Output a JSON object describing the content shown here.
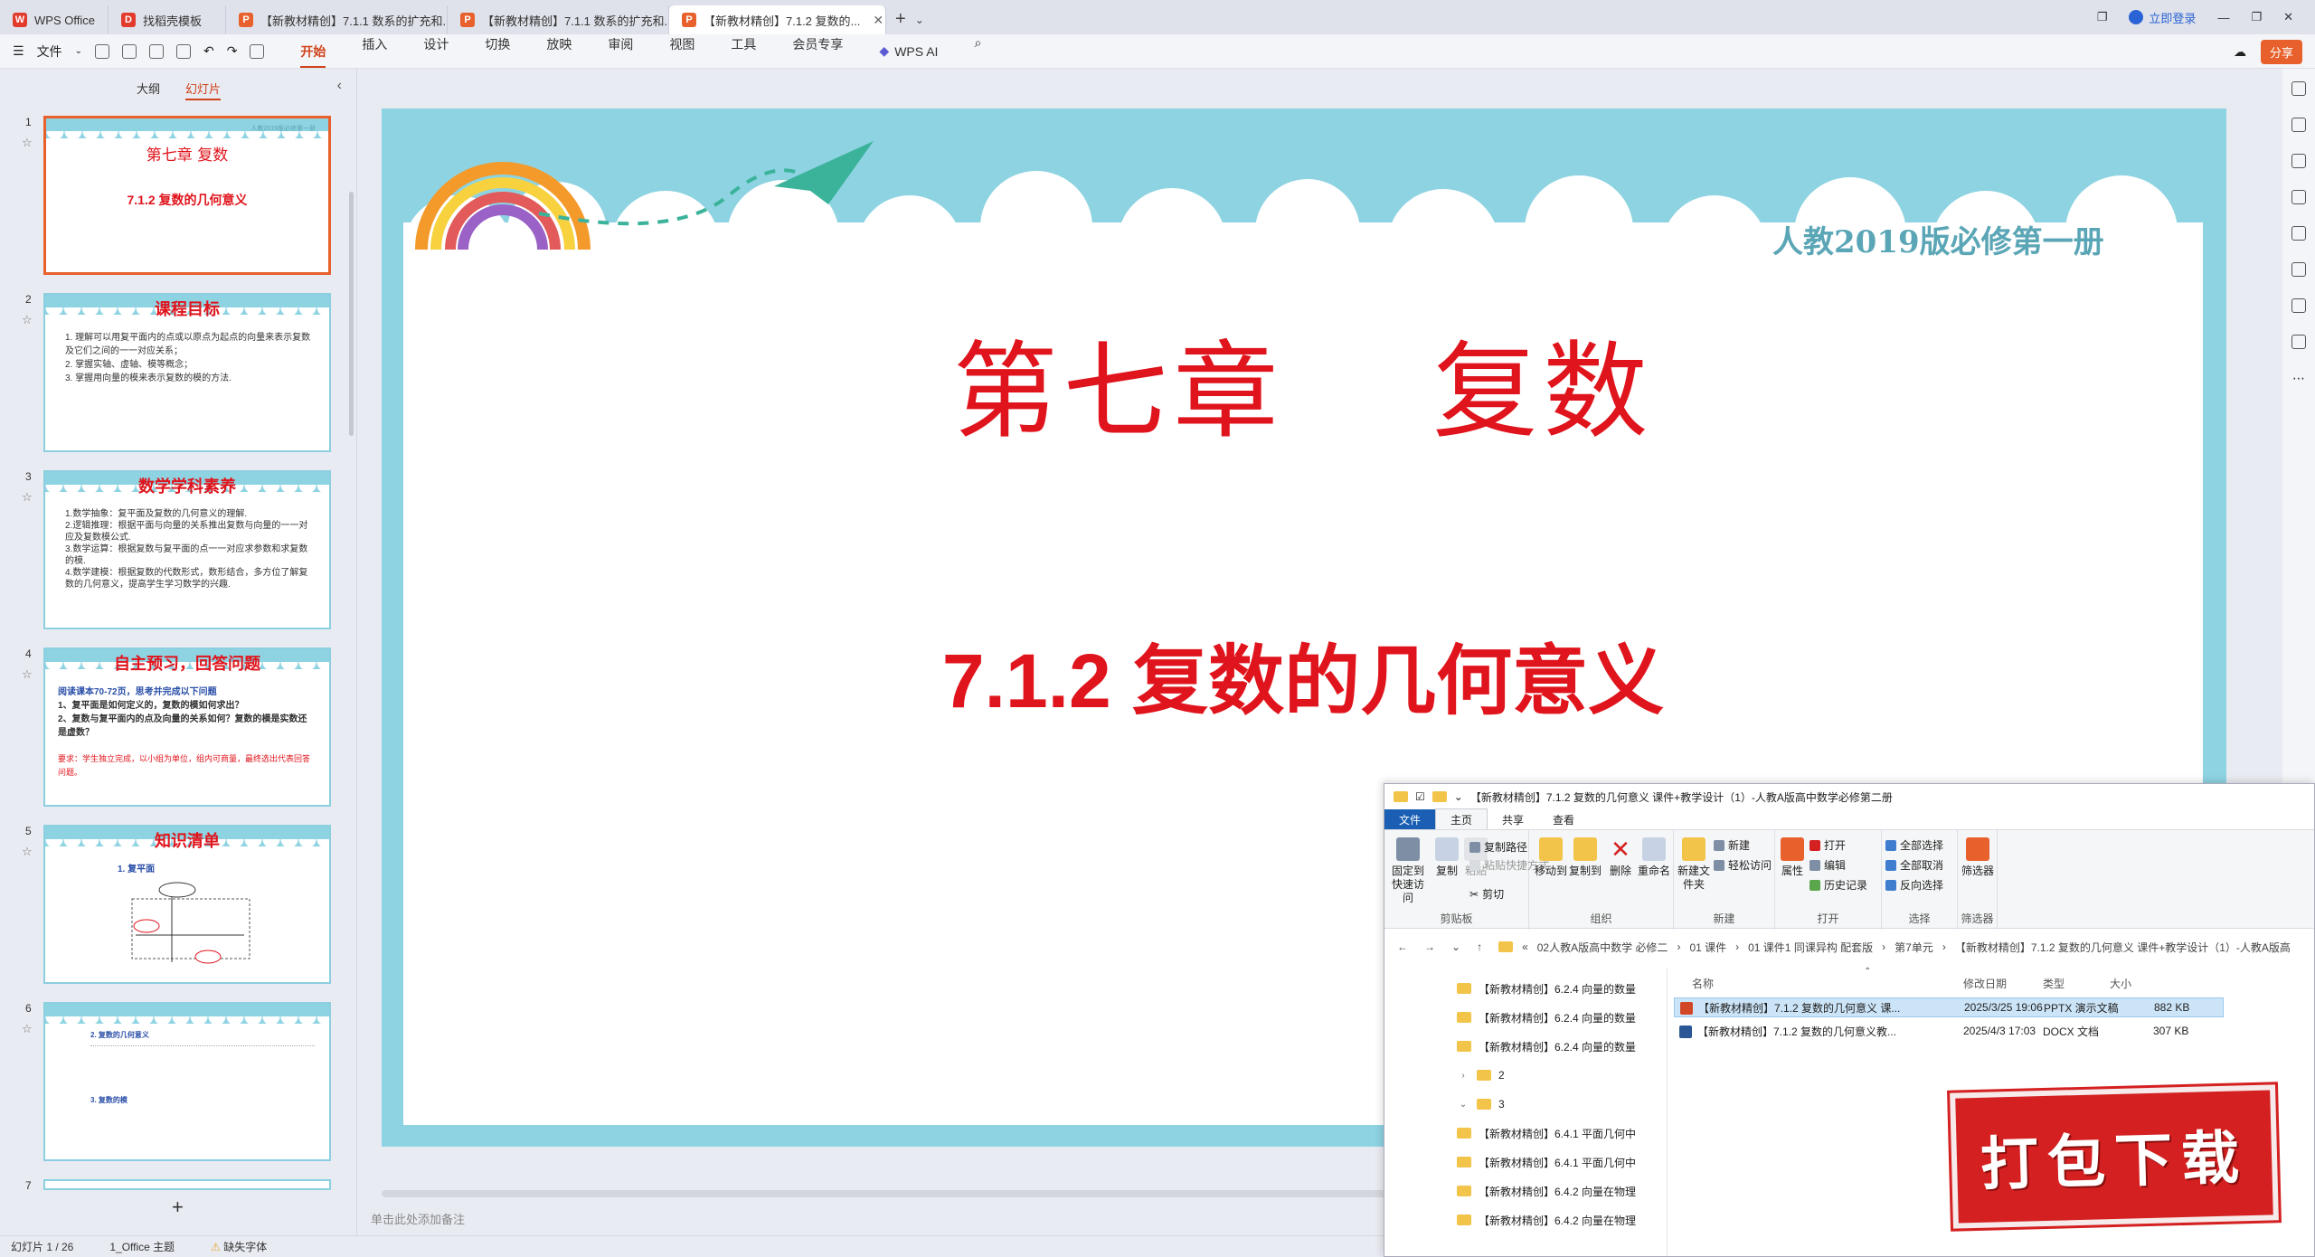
{
  "tabs": [
    {
      "label": "WPS Office",
      "color": "#e23b2e",
      "glyph": "W"
    },
    {
      "label": "找稻壳模板",
      "color": "#e23b2e",
      "glyph": "D"
    },
    {
      "label": "【新教材精创】7.1.1 数系的扩充和...",
      "color": "#e8612c",
      "glyph": "P"
    },
    {
      "label": "【新教材精创】7.1.1 数系的扩充和...",
      "color": "#e8612c",
      "glyph": "P"
    },
    {
      "label": "【新教材精创】7.1.2 复数的...",
      "color": "#e8612c",
      "glyph": "P"
    }
  ],
  "window": {
    "login": "立即登录"
  },
  "menubar": {
    "file": "文件",
    "items": [
      "开始",
      "插入",
      "设计",
      "切换",
      "放映",
      "审阅",
      "视图",
      "工具",
      "会员专享"
    ],
    "active": "开始",
    "wps_ai": "WPS AI",
    "share": "分享"
  },
  "thumb_panel": {
    "tab_outline": "大纲",
    "tab_slides": "幻灯片",
    "slides": [
      {
        "num": "1",
        "chapter": "第七章  复数",
        "lesson": "7.1.2 复数的几何意义",
        "sub": "人教2019版必修第一册"
      },
      {
        "num": "2",
        "title": "课程目标",
        "lines": [
          "1. 理解可以用复平面内的点或以原点为起点的向量来表示复数及它们之间的一一对应关系；",
          "2. 掌握实轴、虚轴、模等概念；",
          "3. 掌握用向量的模来表示复数的模的方法."
        ]
      },
      {
        "num": "3",
        "title": "数学学科素养",
        "lines": [
          "1.数学抽象：复平面及复数的几何意义的理解.",
          "2.逻辑推理：根据平面与向量的关系推出复数与向量的一一对应及复数模公式.",
          "3.数学运算：根据复数与复平面的点一一对应求参数和求复数的模.",
          "4.数学建模：根据复数的代数形式，数形结合，多方位了解复数的几何意义，提高学生学习数学的兴趣."
        ]
      },
      {
        "num": "4",
        "title": "自主预习，回答问题",
        "lines": [
          "阅读课本70-72页，思考并完成以下问题",
          "1、复平面是如何定义的，复数的模如何求出？",
          "2、复数与复平面内的点及向量的关系如何？复数的模是实数还是虚数？"
        ],
        "note": "要求：学生独立完成，以小组为单位，组内可商量，最终选出代表回答问题。"
      },
      {
        "num": "5",
        "title": "知识清单",
        "lines": [
          "1. 复平面"
        ]
      },
      {
        "num": "6",
        "title": "",
        "lines": [
          "2. 复数的几何意义",
          "3. 复数的模"
        ]
      },
      {
        "num": "7"
      }
    ],
    "add": "+"
  },
  "slide": {
    "subtitle": "人教2019版必修第一册",
    "chapter": "第七章　 复数",
    "lesson": "7.1.2 复数的几何意义"
  },
  "notes_placeholder": "单击此处添加备注",
  "status": {
    "slide_count": "幻灯片 1 / 26",
    "theme": "1_Office 主题",
    "font_warning": "缺失字体"
  },
  "explorer": {
    "title": "【新教材精创】7.1.2 复数的几何意义 课件+教学设计（1）-人教A版高中数学必修第二册",
    "tabs": {
      "file": "文件",
      "home": "主页",
      "share": "共享",
      "view": "查看"
    },
    "ribbon": {
      "pin": "固定到快速访问",
      "copy": "复制",
      "paste": "粘贴",
      "copy_path": "复制路径",
      "paste_shortcut": "粘贴快捷方式",
      "cut": "剪切",
      "group_clipboard": "剪贴板",
      "move_to": "移动到",
      "copy_to": "复制到",
      "delete": "删除",
      "rename": "重命名",
      "group_organize": "组织",
      "new_folder": "新建文件夹",
      "new_item": "新建",
      "easy_access": "轻松访问",
      "group_new": "新建",
      "properties": "属性",
      "open": "打开",
      "edit": "编辑",
      "history": "历史记录",
      "group_open": "打开",
      "select_all": "全部选择",
      "select_none": "全部取消",
      "invert": "反向选择",
      "group_select": "选择",
      "filter": "筛选器",
      "group_filter": "筛选器"
    },
    "path": [
      "«",
      "02人教A版高中数学 必修二",
      "›",
      "01 课件",
      "›",
      "01 课件1 同课异构 配套版",
      "›",
      "第7单元",
      "›",
      "【新教材精创】7.1.2 复数的几何意义 课件+教学设计（1）-人教A版高"
    ],
    "nav": [
      {
        "label": "【新教材精创】6.2.4 向量的数量",
        "indent": 1,
        "arrow": ""
      },
      {
        "label": "【新教材精创】6.2.4 向量的数量",
        "indent": 1,
        "arrow": ""
      },
      {
        "label": "【新教材精创】6.2.4 向量的数量",
        "indent": 1,
        "arrow": ""
      },
      {
        "label": "2",
        "indent": 0,
        "arrow": "›"
      },
      {
        "label": "3",
        "indent": 0,
        "arrow": "⌄"
      },
      {
        "label": "【新教材精创】6.4.1 平面几何中",
        "indent": 1,
        "arrow": ""
      },
      {
        "label": "【新教材精创】6.4.1 平面几何中",
        "indent": 1,
        "arrow": ""
      },
      {
        "label": "【新教材精创】6.4.2 向量在物理",
        "indent": 1,
        "arrow": ""
      },
      {
        "label": "【新教材精创】6.4.2 向量在物理",
        "indent": 1,
        "arrow": ""
      }
    ],
    "columns": {
      "name": "名称",
      "date": "修改日期",
      "type": "类型",
      "size": "大小"
    },
    "files": [
      {
        "name": "【新教材精创】7.1.2 复数的几何意义 课...",
        "date": "2025/3/25 19:06",
        "type": "PPTX 演示文稿",
        "size": "882 KB",
        "icon": "#d24726"
      },
      {
        "name": "【新教材精创】7.1.2 复数的几何意义教...",
        "date": "2025/4/3 17:03",
        "type": "DOCX 文档",
        "size": "307 KB",
        "icon": "#2b5797"
      }
    ]
  },
  "badge": "打包下载"
}
